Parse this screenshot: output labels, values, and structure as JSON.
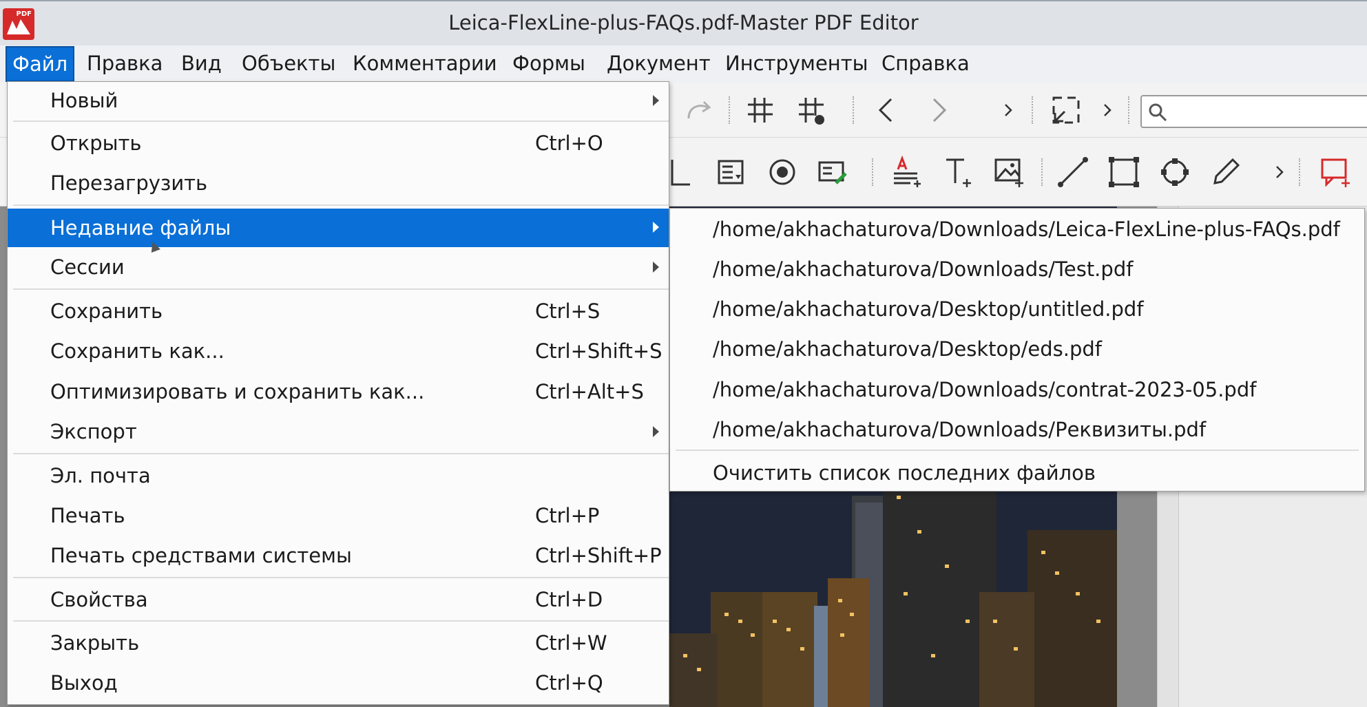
{
  "window": {
    "title": "Leica-FlexLine-plus-FAQs.pdf-Master PDF Editor",
    "logo_text": "PDF"
  },
  "menubar": {
    "items": [
      "Файл",
      "Правка",
      "Вид",
      "Объекты",
      "Комментарии",
      "Формы",
      "Документ",
      "Инструменты",
      "Справка"
    ],
    "active_index": 0
  },
  "file_menu": {
    "items": [
      {
        "label": "Новый",
        "shortcut": "",
        "submenu": true
      },
      {
        "label": "Открыть",
        "shortcut": "Ctrl+O",
        "submenu": false
      },
      {
        "label": "Перезагрузить",
        "shortcut": "",
        "submenu": false
      },
      {
        "label": "Недавние файлы",
        "shortcut": "",
        "submenu": true,
        "highlighted": true
      },
      {
        "label": "Сессии",
        "shortcut": "",
        "submenu": true
      },
      {
        "label": "Сохранить",
        "shortcut": "Ctrl+S",
        "submenu": false
      },
      {
        "label": "Сохранить как...",
        "shortcut": "Ctrl+Shift+S",
        "submenu": false
      },
      {
        "label": "Оптимизировать и сохранить как...",
        "shortcut": "Ctrl+Alt+S",
        "submenu": false
      },
      {
        "label": "Экспорт",
        "shortcut": "",
        "submenu": true
      },
      {
        "label": "Эл. почта",
        "shortcut": "",
        "submenu": false
      },
      {
        "label": "Печать",
        "shortcut": "Ctrl+P",
        "submenu": false
      },
      {
        "label": "Печать средствами системы",
        "shortcut": "Ctrl+Shift+P",
        "submenu": false
      },
      {
        "label": "Свойства",
        "shortcut": "Ctrl+D",
        "submenu": false
      },
      {
        "label": "Закрыть",
        "shortcut": "Ctrl+W",
        "submenu": false
      },
      {
        "label": "Выход",
        "shortcut": "Ctrl+Q",
        "submenu": false
      }
    ]
  },
  "recent_files": {
    "items": [
      "/home/akhachaturova/Downloads/Leica-FlexLine-plus-FAQs.pdf",
      "/home/akhachaturova/Downloads/Test.pdf",
      "/home/akhachaturova/Desktop/untitled.pdf",
      "/home/akhachaturova/Desktop/eds.pdf",
      "/home/akhachaturova/Downloads/contrat-2023-05.pdf",
      "/home/akhachaturova/Downloads/Реквизиты.pdf"
    ],
    "clear_label": "Очистить список последних файлов"
  },
  "toolbar": {
    "row1_icons": [
      "redo-icon",
      "grid-icon",
      "snap-grid-icon",
      "prev-page-icon",
      "next-page-icon",
      "overflow-chevron-icon",
      "fit-page-icon",
      "overflow-chevron-icon",
      "search-icon"
    ],
    "row2_icons": [
      "text-field-icon",
      "list-box-icon",
      "radio-button-icon",
      "signature-field-icon",
      "edit-text-icon",
      "add-text-icon",
      "add-image-icon",
      "line-icon",
      "rectangle-icon",
      "shape-icon",
      "pencil-icon",
      "overflow-chevron-icon",
      "comment-icon"
    ]
  },
  "colors": {
    "accent": "#0a6fd6",
    "menu_bg": "#fbfbfb",
    "logo_red": "#d62a2a",
    "comment_red": "#d62a2a"
  }
}
